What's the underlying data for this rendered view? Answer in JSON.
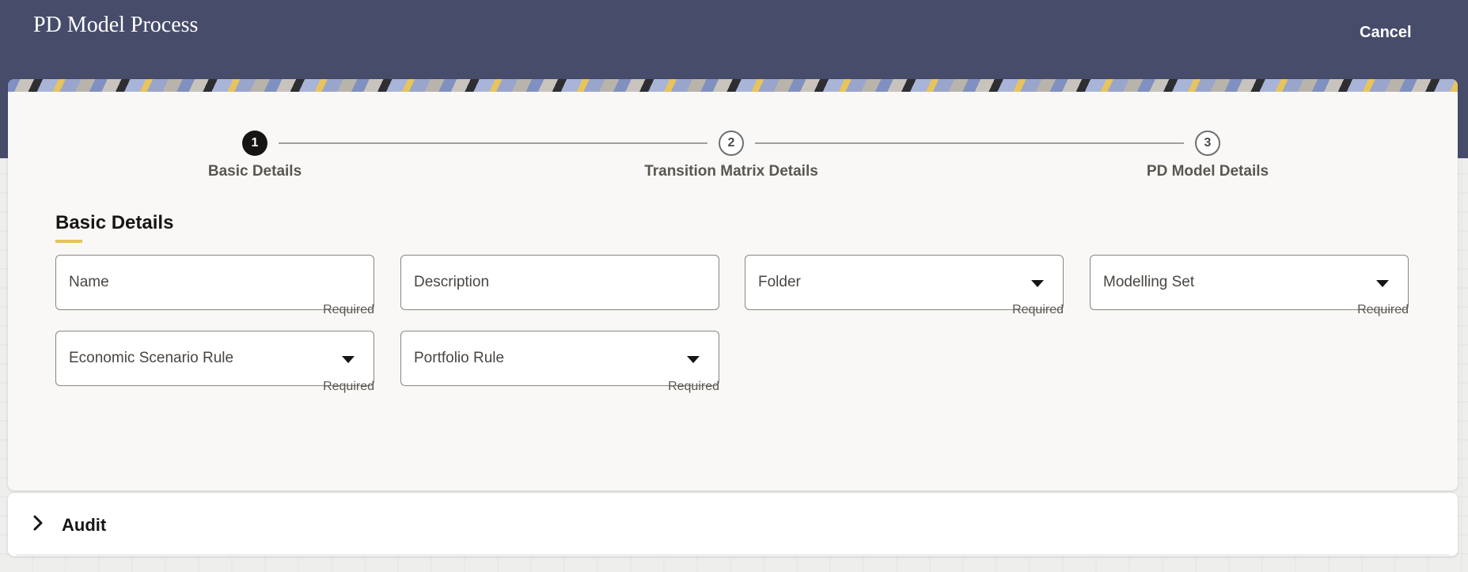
{
  "header": {
    "title": "PD Model Process",
    "cancel_label": "Cancel"
  },
  "stepper": {
    "steps": [
      {
        "number": "1",
        "label": "Basic Details",
        "state": "active"
      },
      {
        "number": "2",
        "label": "Transition Matrix Details",
        "state": "inactive"
      },
      {
        "number": "3",
        "label": "PD Model Details",
        "state": "inactive"
      }
    ]
  },
  "section": {
    "title": "Basic Details"
  },
  "fields": {
    "name": {
      "label": "Name",
      "helper": "Required"
    },
    "description": {
      "label": "Description"
    },
    "folder": {
      "label": "Folder",
      "helper": "Required"
    },
    "modelling_set": {
      "label": "Modelling Set",
      "helper": "Required"
    },
    "economic_scenario_rule": {
      "label": "Economic Scenario Rule",
      "helper": "Required"
    },
    "portfolio_rule": {
      "label": "Portfolio Rule",
      "helper": "Required"
    }
  },
  "audit": {
    "title": "Audit"
  },
  "colors": {
    "header_bg": "#474c6b",
    "accent": "#e6c35c",
    "card_bg": "#f9f8f6"
  }
}
